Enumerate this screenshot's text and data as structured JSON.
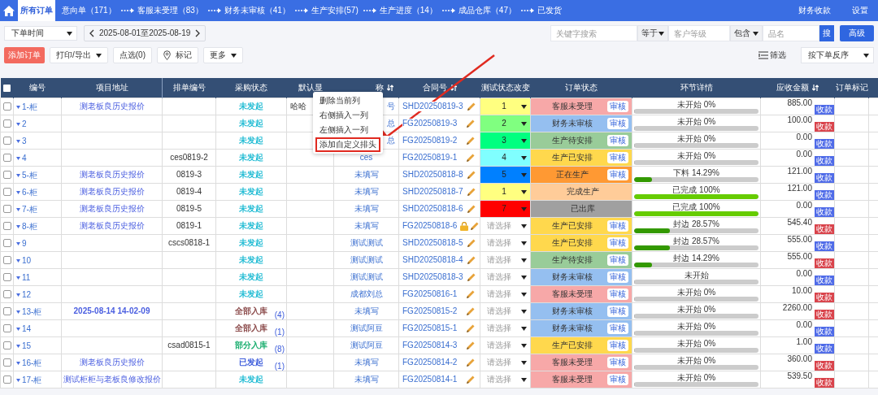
{
  "nav": {
    "tabs": [
      {
        "label": "所有订单",
        "selected": true,
        "arrow": false
      },
      {
        "label": "意向单（171）",
        "selected": false,
        "arrow": false
      },
      {
        "label": "客服未受理（83）",
        "selected": false,
        "arrow": true
      },
      {
        "label": "财务未审核（41）",
        "selected": false,
        "arrow": true
      },
      {
        "label": "生产安排(57)",
        "selected": false,
        "arrow": true
      },
      {
        "label": "生产进度（14）",
        "selected": false,
        "arrow": true
      },
      {
        "label": "成品仓库（47）",
        "selected": false,
        "arrow": true
      },
      {
        "label": "已发货",
        "selected": false,
        "arrow": true
      }
    ],
    "right_links": [
      "财务收款",
      "设置"
    ]
  },
  "filters": {
    "time_field": "下单时间",
    "date_range": "2025-08-01至2025-08-19",
    "keyword": {
      "placeholder": "关键字搜索"
    },
    "operator_1": "等于",
    "customer_level": {
      "placeholder": "客户等级"
    },
    "operator_2": "包含",
    "product_name": {
      "placeholder": "品名"
    },
    "search_button": "搜",
    "advanced_button": "高级"
  },
  "actions": {
    "add_order": "添加订单",
    "print_export": "打印/导出",
    "pick": "点选(0)",
    "mark": "标记",
    "more": "更多",
    "filter": "筛选",
    "sort": "按下单反序"
  },
  "table": {
    "all_checked": false,
    "columns": [
      {
        "label": "编号",
        "sortable": false
      },
      {
        "label": "项目地址",
        "sortable": false
      },
      {
        "label": "排单编号",
        "sortable": false
      },
      {
        "label": "采购状态",
        "sortable": false
      },
      {
        "label": "默认显",
        "sortable": false
      },
      {
        "label": "称",
        "sortable": true
      },
      {
        "label": "合同号",
        "sortable": true
      },
      {
        "label": "测试状态改变",
        "sortable": false
      },
      {
        "label": "订单状态",
        "sortable": false
      },
      {
        "label": "环节详情",
        "sortable": false
      },
      {
        "label": "应收金额",
        "sortable": true
      },
      {
        "label": "订单标记",
        "sortable": false
      }
    ],
    "rows": [
      {
        "checked": false,
        "no": "1-柜",
        "address": "测老板良历史报价",
        "schedule": "",
        "purchase": {
          "text": "未发起",
          "color": "#22bcd4"
        },
        "default": "哈哈",
        "name": "号",
        "name_partial": true,
        "contract": "SHD20250819-3",
        "locked": false,
        "test": {
          "value": "1",
          "color": "#ffff80"
        },
        "order_status": {
          "text": "客服未受理",
          "color": "#f7a8a8",
          "audit": "审核"
        },
        "progress": {
          "label": "未开始 0%",
          "level": 0
        },
        "amount": "885.00",
        "pay": {
          "label": "收款",
          "color": "#4f6be8"
        }
      },
      {
        "checked": false,
        "no": "2",
        "address": "",
        "schedule": "",
        "purchase": {
          "text": "未发起",
          "color": "#22bcd4"
        },
        "default": "",
        "name": "总",
        "name_partial": true,
        "contract": "FG20250819-3",
        "locked": false,
        "test": {
          "value": "2",
          "color": "#80ff80"
        },
        "order_status": {
          "text": "财务未审核",
          "color": "#95bff0",
          "audit": "审核"
        },
        "progress": {
          "label": "未开始 0%",
          "level": 0
        },
        "amount": "100.00",
        "pay": {
          "label": "收款",
          "color": "#d9434b"
        }
      },
      {
        "checked": false,
        "no": "3",
        "address": "",
        "schedule": "",
        "purchase": {
          "text": "未发起",
          "color": "#22bcd4"
        },
        "default": "",
        "name": "总",
        "name_partial": true,
        "contract": "FG20250819-2",
        "locked": false,
        "test": {
          "value": "3",
          "color": "#00ff80"
        },
        "order_status": {
          "text": "生产待安排",
          "color": "#99cc99",
          "audit": "审核"
        },
        "progress": {
          "label": "未开始 0%",
          "level": 0
        },
        "amount": "0.00",
        "pay": {
          "label": "收款",
          "color": "#4f6be8"
        }
      },
      {
        "checked": false,
        "no": "4",
        "address": "",
        "schedule": "ces0819-2",
        "purchase": {
          "text": "未发起",
          "color": "#22bcd4"
        },
        "default": "",
        "name": "ces",
        "name_partial": false,
        "contract": "FG20250819-1",
        "locked": false,
        "test": {
          "value": "4",
          "color": "#80ffff"
        },
        "order_status": {
          "text": "生产已安排",
          "color": "#ffd84d",
          "audit": "审核"
        },
        "progress": {
          "label": "未开始 0%",
          "level": 0
        },
        "amount": "0.00",
        "pay": {
          "label": "收款",
          "color": "#4f6be8"
        }
      },
      {
        "checked": false,
        "no": "5-柜",
        "address": "测老板良历史报价",
        "schedule": "0819-3",
        "purchase": {
          "text": "未发起",
          "color": "#22bcd4"
        },
        "default": "",
        "name": "未填写",
        "name_partial": false,
        "contract": "SHD20250818-8",
        "locked": false,
        "test": {
          "value": "5",
          "color": "#0080ff"
        },
        "order_status": {
          "text": "正在生产",
          "color": "#ff9933",
          "audit": "审核"
        },
        "progress": {
          "label": "下料 14.29%",
          "level": 0.1429,
          "color": "#339900"
        },
        "amount": "121.00",
        "pay": {
          "label": "收款",
          "color": "#4f6be8"
        }
      },
      {
        "checked": false,
        "no": "6-柜",
        "address": "测老板良历史报价",
        "schedule": "0819-4",
        "purchase": {
          "text": "未发起",
          "color": "#22bcd4"
        },
        "default": "",
        "name": "未填写",
        "name_partial": false,
        "contract": "SHD20250818-7",
        "locked": false,
        "test": {
          "value": "1",
          "color": "#ffff80"
        },
        "order_status": {
          "text": "完成生产",
          "color": "#ffcc99"
        },
        "progress": {
          "label": "已完成 100%",
          "level": 1,
          "color": "#66cc00"
        },
        "amount": "121.00",
        "pay": {
          "label": "收款",
          "color": "#4f6be8"
        }
      },
      {
        "checked": false,
        "no": "7-柜",
        "address": "测老板良历史报价",
        "schedule": "0819-5",
        "purchase": {
          "text": "未发起",
          "color": "#22bcd4"
        },
        "default": "",
        "name": "未填写",
        "name_partial": false,
        "contract": "SHD20250818-6",
        "locked": false,
        "test": {
          "value": "7",
          "color": "#ff0000"
        },
        "order_status": {
          "text": "已出库",
          "color": "#a0a0a0"
        },
        "progress": {
          "label": "已完成 100%",
          "level": 1,
          "color": "#66cc00"
        },
        "amount": "0.00",
        "pay": {
          "label": "收款",
          "color": "#4f6be8"
        }
      },
      {
        "checked": false,
        "no": "8-柜",
        "address": "测老板良历史报价",
        "schedule": "0819-1",
        "purchase": {
          "text": "未发起",
          "color": "#22bcd4"
        },
        "default": "",
        "name": "未填写",
        "name_partial": false,
        "contract": "FG20250818-6",
        "locked": true,
        "test": {
          "placeholder": "请选择"
        },
        "order_status": {
          "text": "生产已安排",
          "color": "#ffd84d",
          "audit": "审核"
        },
        "progress": {
          "label": "封边 28.57%",
          "level": 0.2857,
          "color": "#339900"
        },
        "amount": "545.40",
        "pay": {
          "label": "收款",
          "color": "#d9434b"
        }
      },
      {
        "checked": false,
        "no": "9",
        "address": "",
        "schedule": "cscs0818-1",
        "purchase": {
          "text": "未发起",
          "color": "#22bcd4"
        },
        "default": "",
        "name": "测试测试",
        "name_partial": false,
        "contract": "SHD20250818-5",
        "locked": false,
        "test": {
          "placeholder": "请选择"
        },
        "order_status": {
          "text": "生产已安排",
          "color": "#ffd84d",
          "audit": "审核"
        },
        "progress": {
          "label": "封边 28.57%",
          "level": 0.2857,
          "color": "#339900"
        },
        "amount": "555.00",
        "pay": {
          "label": "收款",
          "color": "#4f6be8"
        }
      },
      {
        "checked": false,
        "no": "10",
        "address": "",
        "schedule": "",
        "purchase": {
          "text": "未发起",
          "color": "#22bcd4"
        },
        "default": "",
        "name": "测试测试",
        "name_partial": false,
        "contract": "SHD20250818-4",
        "locked": false,
        "test": {
          "placeholder": "请选择"
        },
        "order_status": {
          "text": "生产待安排",
          "color": "#99cc99",
          "audit": "审核"
        },
        "progress": {
          "label": "封边 14.29%",
          "level": 0.1429,
          "color": "#339900"
        },
        "amount": "555.00",
        "pay": {
          "label": "收款",
          "color": "#d9434b"
        }
      },
      {
        "checked": false,
        "no": "11",
        "address": "",
        "schedule": "",
        "purchase": {
          "text": "未发起",
          "color": "#22bcd4"
        },
        "default": "",
        "name": "测试测试",
        "name_partial": false,
        "contract": "SHD20250818-3",
        "locked": false,
        "test": {
          "placeholder": "请选择"
        },
        "order_status": {
          "text": "财务未审核",
          "color": "#95bff0",
          "audit": "审核"
        },
        "progress": {
          "label": "未开始",
          "level": 0
        },
        "amount": "0.00",
        "pay": {
          "label": "收款",
          "color": "#4f6be8"
        }
      },
      {
        "checked": false,
        "no": "12",
        "address": "",
        "schedule": "",
        "purchase": {
          "text": "未发起",
          "color": "#22bcd4"
        },
        "default": "",
        "name": "成都刘总",
        "name_partial": false,
        "contract": "FG20250816-1",
        "locked": false,
        "test": {
          "placeholder": "请选择"
        },
        "order_status": {
          "text": "客服未受理",
          "color": "#f7a8a8",
          "audit": "审核"
        },
        "progress": {
          "label": "未开始 0%",
          "level": 0
        },
        "amount": "10.00",
        "pay": {
          "label": "收款",
          "color": "#d9434b"
        }
      },
      {
        "checked": false,
        "no": "13-柜",
        "address": "2025-08-14 14-02-09",
        "address_bold": true,
        "schedule": "",
        "purchase": {
          "text": "全部入库",
          "color": "#8b4a4a",
          "count": "(4)"
        },
        "default": "",
        "name": "未填写",
        "name_partial": false,
        "contract": "FG20250815-2",
        "locked": false,
        "test": {
          "placeholder": "请选择"
        },
        "order_status": {
          "text": "财务未审核",
          "color": "#95bff0",
          "audit": "审核"
        },
        "progress": {
          "label": "未开始 0%",
          "level": 0
        },
        "amount": "2260.00",
        "pay": {
          "label": "收款",
          "color": "#d9434b"
        }
      },
      {
        "checked": false,
        "no": "14",
        "address": "",
        "schedule": "",
        "purchase": {
          "text": "全部入库",
          "color": "#8b4a4a",
          "count": "(1)"
        },
        "default": "",
        "name": "测试阿豆",
        "name_partial": false,
        "contract": "FG20250815-1",
        "locked": false,
        "test": {
          "placeholder": "请选择"
        },
        "order_status": {
          "text": "财务未审核",
          "color": "#95bff0",
          "audit": "审核"
        },
        "progress": {
          "label": "未开始 0%",
          "level": 0
        },
        "amount": "0.00",
        "pay": {
          "label": "收款",
          "color": "#4f6be8"
        }
      },
      {
        "checked": false,
        "no": "15",
        "address": "",
        "schedule": "csad0815-1",
        "purchase": {
          "text": "部分入库",
          "color": "#1aae6f",
          "count": "(8)"
        },
        "default": "",
        "name": "测试阿豆",
        "name_partial": false,
        "contract": "FG20250814-3",
        "locked": false,
        "test": {
          "placeholder": "请选择"
        },
        "order_status": {
          "text": "生产已安排",
          "color": "#ffd84d",
          "audit": "审核"
        },
        "progress": {
          "label": "未开始 0%",
          "level": 0
        },
        "amount": "1.00",
        "pay": {
          "label": "收款",
          "color": "#4f6be8"
        }
      },
      {
        "checked": false,
        "no": "16-柜",
        "address": "测老板良历史报价",
        "schedule": "",
        "purchase": {
          "text": "已发起",
          "color": "#3b5bdb",
          "count": "(1)"
        },
        "default": "",
        "name": "未填写",
        "name_partial": false,
        "contract": "FG20250814-2",
        "locked": false,
        "test": {
          "placeholder": "请选择"
        },
        "order_status": {
          "text": "客服未受理",
          "color": "#f7a8a8",
          "audit": "审核"
        },
        "progress": {
          "label": "未开始 0%",
          "level": 0
        },
        "amount": "360.00",
        "pay": {
          "label": "收款",
          "color": "#d9434b"
        }
      },
      {
        "checked": false,
        "no": "17-柜",
        "address": "测试柜柜与老板良修改报价",
        "schedule": "",
        "purchase": {
          "text": "未发起",
          "color": "#22bcd4"
        },
        "default": "",
        "name": "未填写",
        "name_partial": false,
        "contract": "FG20250814-1",
        "locked": false,
        "test": {
          "placeholder": "请选择"
        },
        "order_status": {
          "text": "客服未受理",
          "color": "#f7a8a8",
          "audit": "审核"
        },
        "progress": {
          "label": "未开始 0%",
          "level": 0
        },
        "amount": "539.50",
        "pay": {
          "label": "收款",
          "color": "#d9434b"
        }
      }
    ]
  },
  "context_menu": {
    "items": [
      {
        "label": "删除当前列",
        "highlighted": false
      },
      {
        "label": "右侧插入一列",
        "highlighted": false
      },
      {
        "label": "左侧插入一列",
        "highlighted": false
      },
      {
        "label": "添加自定义排头",
        "highlighted": true
      }
    ]
  },
  "annotation": {
    "kind": "arrow"
  }
}
